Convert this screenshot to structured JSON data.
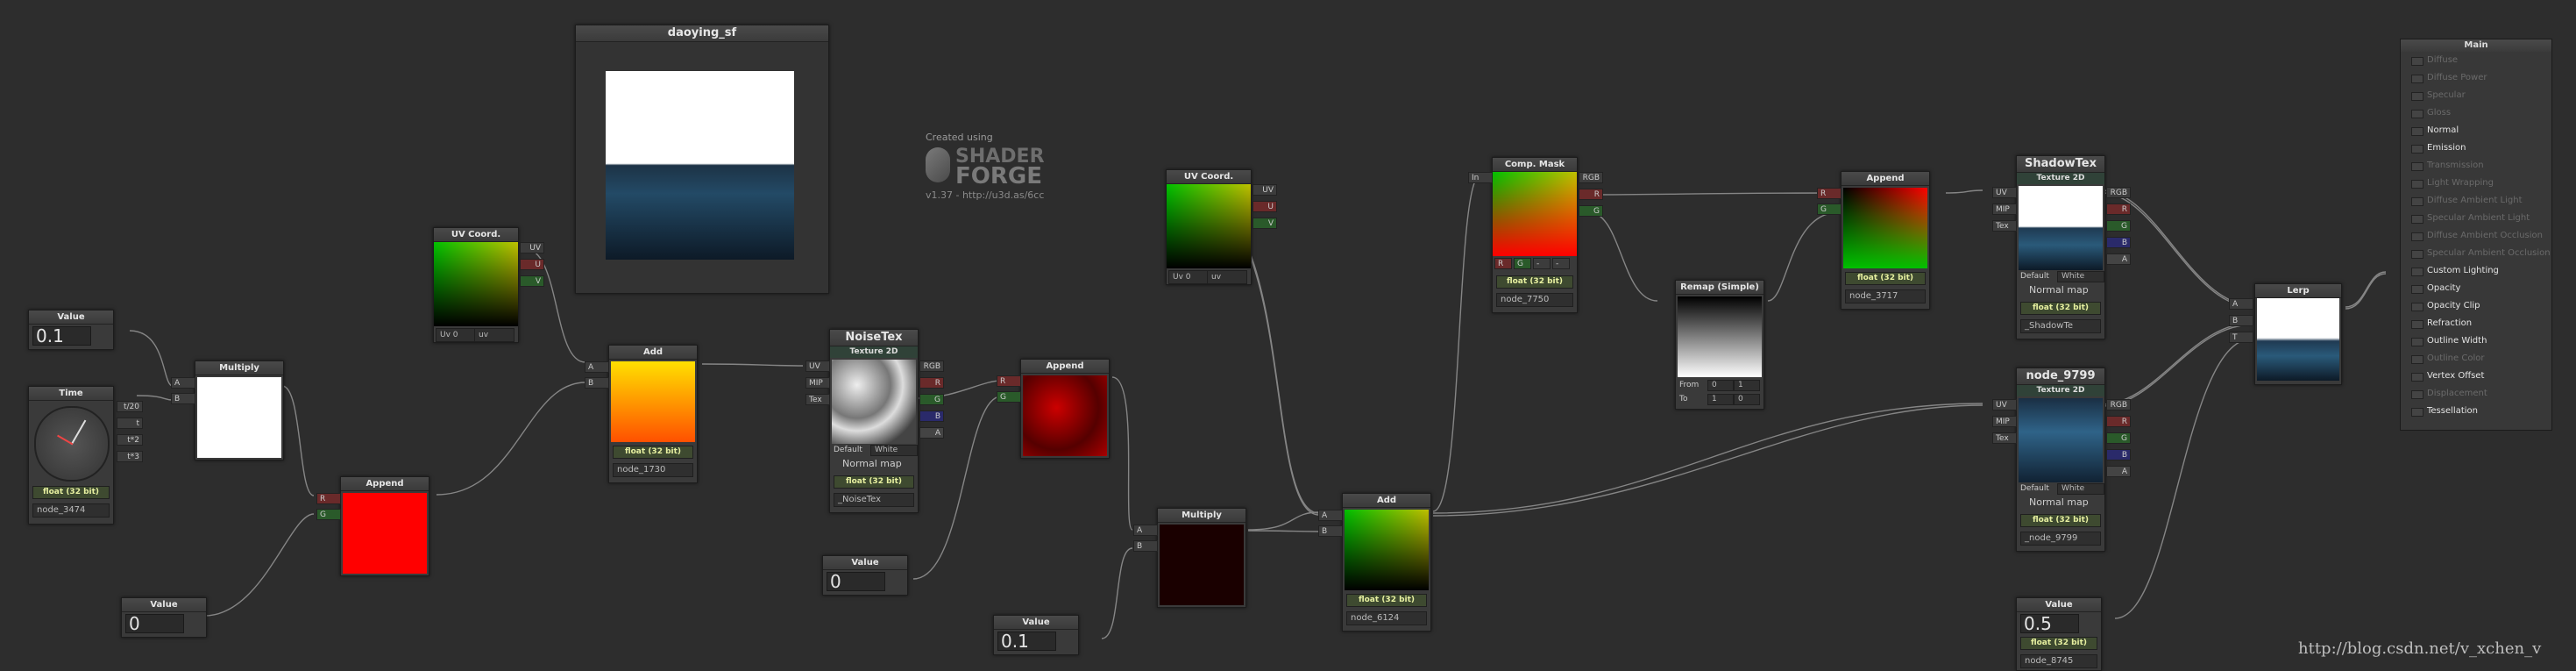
{
  "window": {
    "preview_title": "daoying_sf"
  },
  "branding": {
    "created_using": "Created using",
    "logo_line1": "SHADER",
    "logo_line2": "FORGE",
    "version": "v1.37 - http://u3d.as/6cc"
  },
  "watermark": "http://blog.csdn.net/v_xchen_v",
  "nodes": {
    "value1": {
      "title": "Value",
      "value": "0.1"
    },
    "time": {
      "title": "Time",
      "out1": "t/20",
      "out2": "t",
      "out3": "t*2",
      "out4": "t*3",
      "precision": "float (32 bit)",
      "name": "node_3474"
    },
    "uv1": {
      "title": "UV Coord.",
      "out_uv": "UV",
      "out_u": "U",
      "out_v": "V",
      "uv_sel": "Uv 0",
      "uv_mode": "uv"
    },
    "multiply1": {
      "title": "Multiply",
      "in_a": "A",
      "in_b": "B"
    },
    "append1": {
      "title": "Append",
      "in_r": "R",
      "in_g": "G"
    },
    "value2": {
      "title": "Value",
      "value": "0"
    },
    "add1": {
      "title": "Add",
      "in_a": "A",
      "in_b": "B",
      "precision": "float (32 bit)",
      "name": "node_1730"
    },
    "noisetex": {
      "title": "NoiseTex",
      "subtitle": "Texture 2D",
      "in_uv": "UV",
      "in_mip": "MIP",
      "in_tex": "Tex",
      "out_rgb": "RGB",
      "out_r": "R",
      "out_g": "G",
      "out_b": "B",
      "out_a": "A",
      "default_label": "Default",
      "default_value": "White",
      "normal_map": "Normal map",
      "precision": "float (32 bit)",
      "name": "_NoiseTex"
    },
    "value3": {
      "title": "Value",
      "value": "0"
    },
    "append2": {
      "title": "Append",
      "in_r": "R",
      "in_g": "G"
    },
    "value4": {
      "title": "Value",
      "value": "0.1"
    },
    "multiply2": {
      "title": "Multiply",
      "in_a": "A",
      "in_b": "B"
    },
    "uv2": {
      "title": "UV Coord.",
      "out_uv": "UV",
      "out_u": "U",
      "out_v": "V",
      "uv_sel": "Uv 0",
      "uv_mode": "uv"
    },
    "add2": {
      "title": "Add",
      "in_a": "A",
      "in_b": "B",
      "precision": "float (32 bit)",
      "name": "node_6124"
    },
    "compmask": {
      "title": "Comp. Mask",
      "in": "In",
      "out_rgb": "RGB",
      "out_r": "R",
      "out_g": "G",
      "ch_r": "R",
      "ch_g": "G",
      "ch_x": "-",
      "ch_y": "-",
      "precision": "float (32 bit)",
      "name": "node_7750"
    },
    "remap": {
      "title": "Remap (Simple)",
      "from_label": "From",
      "from_a": "0",
      "from_b": "1",
      "to_label": "To",
      "to_a": "1",
      "to_b": "0"
    },
    "append3": {
      "title": "Append",
      "in_r": "R",
      "in_g": "G",
      "precision": "float (32 bit)",
      "name": "node_3717"
    },
    "shadowtex": {
      "title": "ShadowTex",
      "subtitle": "Texture 2D",
      "in_uv": "UV",
      "in_mip": "MIP",
      "in_tex": "Tex",
      "out_rgb": "RGB",
      "out_r": "R",
      "out_g": "G",
      "out_b": "B",
      "out_a": "A",
      "default_label": "Default",
      "default_value": "White",
      "normal_map": "Normal map",
      "precision": "float (32 bit)",
      "name": "_ShadowTe"
    },
    "node9799": {
      "title": "node_9799",
      "subtitle": "Texture 2D",
      "in_uv": "UV",
      "in_mip": "MIP",
      "in_tex": "Tex",
      "out_rgb": "RGB",
      "out_r": "R",
      "out_g": "G",
      "out_b": "B",
      "out_a": "A",
      "default_label": "Default",
      "default_value": "White",
      "normal_map": "Normal map",
      "precision": "float (32 bit)",
      "name": "_node_9799"
    },
    "value5": {
      "title": "Value",
      "value": "0.5",
      "precision": "float (32 bit)",
      "name": "node_8745"
    },
    "lerp": {
      "title": "Lerp",
      "in_a": "A",
      "in_b": "B",
      "in_t": "T"
    }
  },
  "main_panel": {
    "title": "Main",
    "rows": [
      {
        "label": "Diffuse",
        "active": false
      },
      {
        "label": "Diffuse Power",
        "active": false
      },
      {
        "label": "Specular",
        "active": false
      },
      {
        "label": "Gloss",
        "active": false
      },
      {
        "label": "Normal",
        "active": true
      },
      {
        "label": "Emission",
        "active": true
      },
      {
        "label": "Transmission",
        "active": false
      },
      {
        "label": "Light Wrapping",
        "active": false
      },
      {
        "label": "Diffuse Ambient Light",
        "active": false
      },
      {
        "label": "Specular Ambient Light",
        "active": false
      },
      {
        "label": "Diffuse Ambient Occlusion",
        "active": false
      },
      {
        "label": "Specular Ambient Occlusion",
        "active": false
      },
      {
        "label": "Custom Lighting",
        "active": true
      },
      {
        "label": "Opacity",
        "active": true
      },
      {
        "label": "Opacity Clip",
        "active": true
      },
      {
        "label": "Refraction",
        "active": true
      },
      {
        "label": "Outline Width",
        "active": true
      },
      {
        "label": "Outline Color",
        "active": false
      },
      {
        "label": "Vertex Offset",
        "active": true
      },
      {
        "label": "Displacement",
        "active": false
      },
      {
        "label": "Tessellation",
        "active": true
      }
    ]
  }
}
